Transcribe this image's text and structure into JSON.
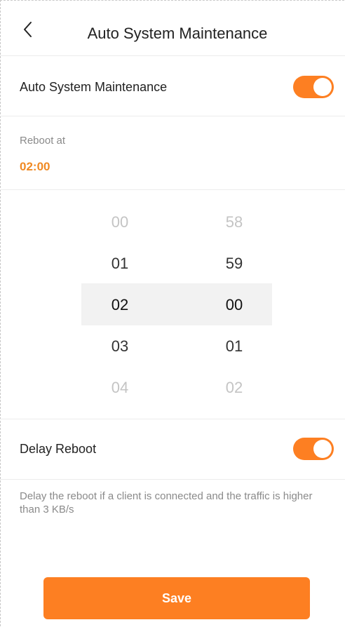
{
  "theme": {
    "accent": "#fd7f22",
    "accent_text": "#f08a24"
  },
  "header": {
    "title": "Auto System Maintenance",
    "back_icon": "chevron-left-icon"
  },
  "auto_maintenance": {
    "label": "Auto System Maintenance",
    "enabled": true
  },
  "reboot": {
    "label": "Reboot at",
    "time": "02:00"
  },
  "picker": {
    "hours": [
      "00",
      "01",
      "02",
      "03",
      "04"
    ],
    "minutes": [
      "58",
      "59",
      "00",
      "01",
      "02"
    ],
    "selected_hour": "02",
    "selected_minute": "00"
  },
  "delay_reboot": {
    "label": "Delay Reboot",
    "enabled": true,
    "description": "Delay the reboot if a client is connected and the traffic is higher than 3 KB/s"
  },
  "footer": {
    "save_label": "Save"
  }
}
